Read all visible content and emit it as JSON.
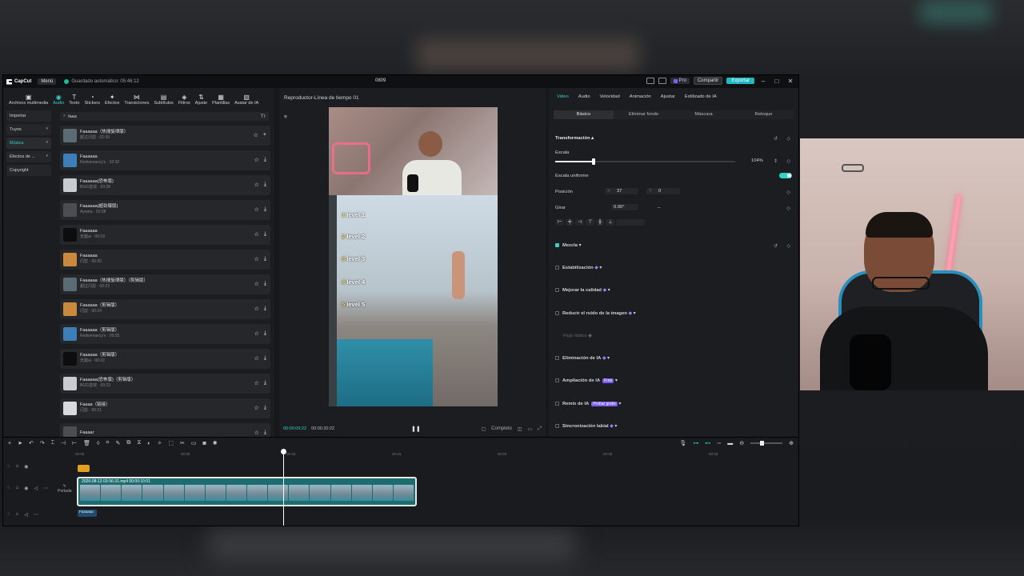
{
  "window": {
    "app_name": "CapCut",
    "menu": "Menú",
    "autosave": "Guardado automático: 05:46:12",
    "project": "0809",
    "pro": "Pro",
    "share": "Compartir",
    "export": "Exportar"
  },
  "toolbar": [
    {
      "label": "Archivos multimedia",
      "glyph": "▣"
    },
    {
      "label": "Audio",
      "glyph": "◉"
    },
    {
      "label": "Texto",
      "glyph": "T"
    },
    {
      "label": "Stickers",
      "glyph": "◔"
    },
    {
      "label": "Efectos",
      "glyph": "✦"
    },
    {
      "label": "Transiciones",
      "glyph": "⋈"
    },
    {
      "label": "Subtítulos",
      "glyph": "▤"
    },
    {
      "label": "Filtros",
      "glyph": "◈"
    },
    {
      "label": "Ajuste",
      "glyph": "⇅"
    },
    {
      "label": "Plantillas",
      "glyph": "▦"
    },
    {
      "label": "Avatar de IA",
      "glyph": "▧"
    }
  ],
  "sidebar": [
    {
      "label": "Importar"
    },
    {
      "label": "Tuyos"
    },
    {
      "label": "Música"
    },
    {
      "label": "Efectos de ..."
    },
    {
      "label": "Copyright"
    }
  ],
  "search": {
    "value": "faaa",
    "filter": "Tт"
  },
  "tracks": [
    {
      "title": "Faaaaaa（热搜旋律版）",
      "sub": "超过闪剪 · 02:39",
      "color": "#5a6b74"
    },
    {
      "title": "Faaaaaa",
      "sub": "Redwenancy's · 02:32",
      "color": "#3d7db8"
    },
    {
      "title": "Faaaaaa(恐怖版)",
      "sub": "BGG音效 · 00:28",
      "color": "#c8ccd0"
    },
    {
      "title": "Faaaaaa(超劲爆版)",
      "sub": "Ayoeta · 02:08",
      "color": "#4a4d52"
    },
    {
      "title": "Faaaaaa",
      "sub": "无敌ai · 00:18",
      "color": "#0d0d0d"
    },
    {
      "title": "Faaaaaa",
      "sub": "闪剪 · 00:20",
      "color": "#c98a3e"
    },
    {
      "title": "Faaaaaa（热搜旋律版）（剪辑版）",
      "sub": "超过闪剪 · 00:23",
      "color": "#5a6b74"
    },
    {
      "title": "Faaaaaa（剪辑版）",
      "sub": "闪剪 · 00:24",
      "color": "#c98a3e"
    },
    {
      "title": "Faaaaaa（剪辑版）",
      "sub": "Redwenancy's · 00:25",
      "color": "#3d7db8"
    },
    {
      "title": "Faaaaaa（剪辑版）",
      "sub": "无敌ai · 00:22",
      "color": "#0d0d0d"
    },
    {
      "title": "Faaaaaa(恐怖版)（剪辑版）",
      "sub": "BGG音效 · 00:23",
      "color": "#c8ccd0"
    },
    {
      "title": "Faaaa（链接）",
      "sub": "闪剪 · 00:21",
      "color": "#d8dadc"
    },
    {
      "title": "Faaaar",
      "sub": "",
      "color": "#4a4d52"
    }
  ],
  "player": {
    "title": "Reproductor-Línea de tiempo 01",
    "current": "00:00:09:22",
    "total": "00:00:20:22",
    "ratio": "Completo",
    "levels": [
      "level 1",
      "level 2",
      "level 3",
      "level 4",
      "level 5"
    ],
    "level_nums": [
      "1",
      "2",
      "3",
      "4",
      "5"
    ]
  },
  "props": {
    "tabs": [
      "Video",
      "Audio",
      "Velocidad",
      "Animación",
      "Ajustar",
      "Estilizado de IA"
    ],
    "subtabs": [
      "Básico",
      "Eliminar fondo",
      "Máscara",
      "Retoque"
    ],
    "transform": "Transformación",
    "scale": "Escala",
    "scale_val": "104%",
    "uniform": "Escala uniforme",
    "position": "Posición",
    "pos_x_label": "X",
    "pos_x": "37",
    "pos_y_label": "Y",
    "pos_y": "0",
    "rotate": "Girar",
    "rotate_val": "0.00°",
    "rotate_dash": "–",
    "blend": "Mezcla",
    "stab": "Estabilización",
    "quality": "Mejorar la calidad",
    "noise": "Reducir el ruido de la imagen",
    "optical": "Flujo óptico",
    "ai_remove": "Eliminación de IA",
    "ai_expand": "Ampliación de IA",
    "free": "Free",
    "remix": "Remix de IA",
    "try": "Probar gratis",
    "lipsync": "Sincronización labial"
  },
  "timeline": {
    "ruler": [
      "00:00",
      "00:05",
      "00:10",
      "00:15",
      "00:20",
      "00:25",
      "00:30"
    ],
    "clip_label": "2026-08-13 03-56-31.mp4  00:00:10:01",
    "cover": "Portada",
    "audio_clip": "Faaaaaa"
  }
}
